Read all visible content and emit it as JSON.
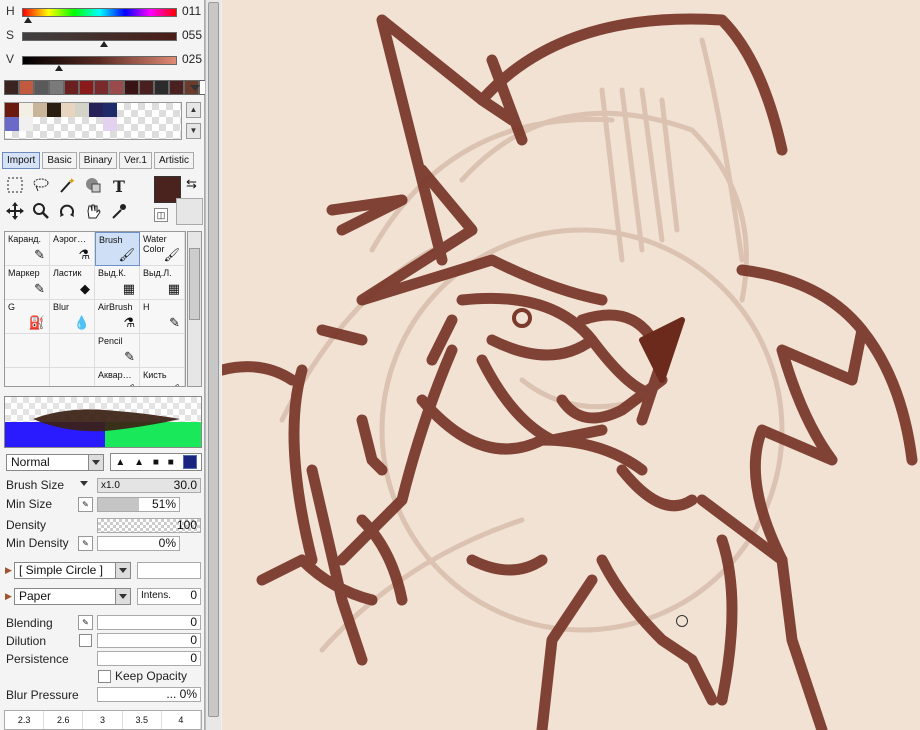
{
  "hsv": {
    "h_label": "H",
    "h_value": "011",
    "s_label": "S",
    "s_value": "055",
    "v_label": "V",
    "v_value": "025"
  },
  "palette": [
    "#3a2320",
    "#c25a3f",
    "#5a5a5a",
    "#7a7a7a",
    "#6b1f1f",
    "#8b1a1a",
    "#7a2a2a",
    "#9a4a4a",
    "#3a1414",
    "#4a1f1f",
    "#2b2b2b",
    "#4a2020",
    "#6a3a2a",
    "#ffffff"
  ],
  "scratch_colors": [
    "#6b1a10",
    "#f3efe4",
    "#c9b59a",
    "#2a1e12",
    "#e8d5c0",
    "#d3d3c8",
    "#27215a",
    "#1f2a68",
    "#6a6ac8",
    "#f0f0f0",
    "#e2d2f0"
  ],
  "tabs": [
    {
      "label": "Import",
      "active": true
    },
    {
      "label": "Basic"
    },
    {
      "label": "Binary"
    },
    {
      "label": "Ver.1"
    },
    {
      "label": "Artistic"
    }
  ],
  "tools": {
    "text_tool": "T"
  },
  "brushes": [
    {
      "label": "Каранд.",
      "icon": "pencil-icon"
    },
    {
      "label": "Аэрог…",
      "icon": "airbrush-icon"
    },
    {
      "label": "Brush",
      "icon": "brush-icon",
      "selected": true
    },
    {
      "label": "Water Color",
      "icon": "watercolor-icon"
    },
    {
      "label": "Маркер",
      "icon": "marker-icon"
    },
    {
      "label": "Ластик",
      "icon": "eraser-icon"
    },
    {
      "label": "Выд.К.",
      "icon": "select-pen-icon"
    },
    {
      "label": "Выд.Л.",
      "icon": "select-eraser-icon"
    },
    {
      "label": "G",
      "icon": "bucket-icon"
    },
    {
      "label": "Blur",
      "icon": "blur-icon"
    },
    {
      "label": "AirBrush",
      "icon": "airbrush2-icon"
    },
    {
      "label": "H",
      "icon": "pencil2-icon"
    },
    {
      "label": "",
      "icon": ""
    },
    {
      "label": "",
      "icon": ""
    },
    {
      "label": "Pencil",
      "icon": "pencil3-icon"
    },
    {
      "label": "",
      "icon": ""
    },
    {
      "label": "",
      "icon": ""
    },
    {
      "label": "",
      "icon": ""
    },
    {
      "label": "Аквар…",
      "icon": "watercolor2-icon"
    },
    {
      "label": "Кисть",
      "icon": "brush2-icon"
    }
  ],
  "blend_mode": "Normal",
  "brush_size": {
    "label": "Brush Size",
    "multiplier": "x1.0",
    "value": "30.0"
  },
  "min_size": {
    "label": "Min Size",
    "value": "51%",
    "fraction": 0.51
  },
  "density": {
    "label": "Density",
    "value": "100"
  },
  "min_density": {
    "label": "Min Density",
    "value": "0%"
  },
  "shape": "[ Simple Circle ]",
  "texture": "Paper",
  "intensity": {
    "label": "Intens.",
    "value": "0"
  },
  "blending": {
    "label": "Blending",
    "value": "0"
  },
  "dilution": {
    "label": "Dilution",
    "value": "0"
  },
  "persistence": {
    "label": "Persistence",
    "value": "0"
  },
  "keep_opacity": "Keep Opacity",
  "blur_pressure": {
    "label": "Blur Pressure",
    "value": "... 0%"
  },
  "sizes": [
    "2.3",
    "2.6",
    "3",
    "3.5",
    "4"
  ]
}
